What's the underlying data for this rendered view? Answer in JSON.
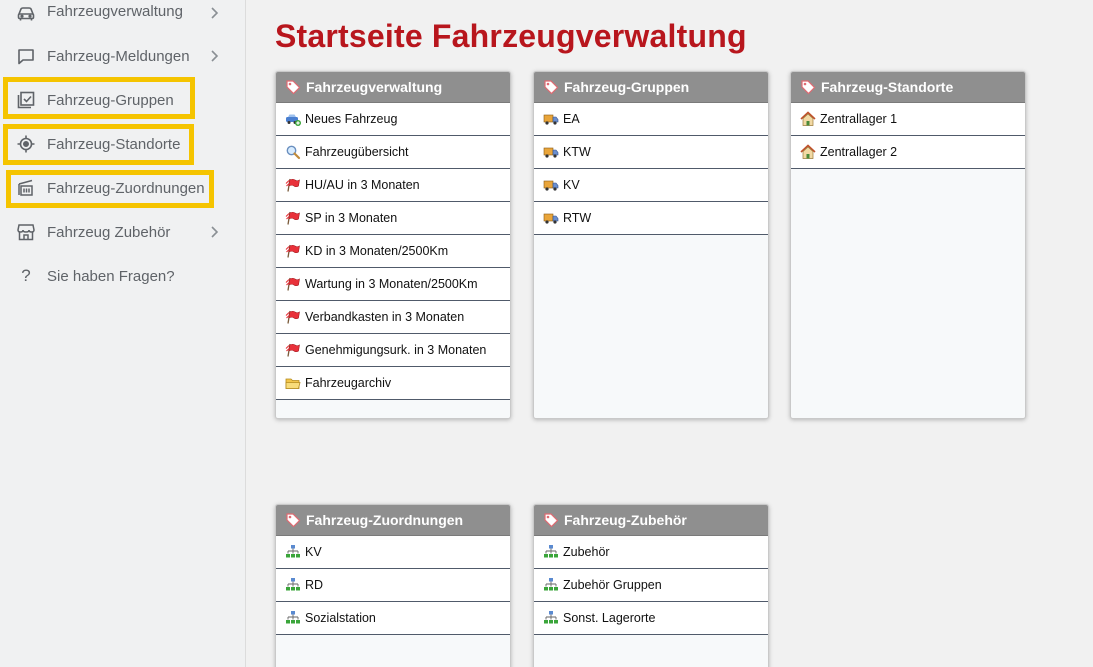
{
  "sidebar": {
    "items": [
      {
        "label": "Fahrzeugverwaltung",
        "icon": "car-icon",
        "has_chevron": true
      },
      {
        "label": "Fahrzeug-Meldungen",
        "icon": "message-icon",
        "has_chevron": true
      },
      {
        "label": "Fahrzeug-Gruppen",
        "icon": "checked-image-icon",
        "has_chevron": false
      },
      {
        "label": "Fahrzeug-Standorte",
        "icon": "target-location-icon",
        "has_chevron": false
      },
      {
        "label": "Fahrzeug-Zuordnungen",
        "icon": "assignment-icon",
        "has_chevron": false
      },
      {
        "label": "Fahrzeug Zubehör",
        "icon": "store-icon",
        "has_chevron": true
      },
      {
        "label": "Sie haben Fragen?",
        "icon": "question-icon",
        "has_chevron": false
      }
    ],
    "highlight_color": "#f5c400"
  },
  "main": {
    "title": "Startseite Fahrzeugverwaltung",
    "title_color": "#b8161d",
    "cards": [
      {
        "title": "Fahrzeugverwaltung",
        "rows": [
          {
            "label": "Neues Fahrzeug",
            "icon": "new-vehicle-icon"
          },
          {
            "label": "Fahrzeugübersicht",
            "icon": "magnifier-icon"
          },
          {
            "label": "HU/AU in 3 Monaten",
            "icon": "red-flag-icon"
          },
          {
            "label": "SP in 3 Monaten",
            "icon": "red-flag-icon"
          },
          {
            "label": "KD in 3 Monaten/2500Km",
            "icon": "red-flag-icon"
          },
          {
            "label": "Wartung in 3 Monaten/2500Km",
            "icon": "red-flag-icon"
          },
          {
            "label": "Verbandkasten in 3 Monaten",
            "icon": "red-flag-icon"
          },
          {
            "label": "Genehmigungsurk. in 3 Monaten",
            "icon": "red-flag-icon"
          },
          {
            "label": "Fahrzeugarchiv",
            "icon": "folder-icon"
          }
        ]
      },
      {
        "title": "Fahrzeug-Gruppen",
        "rows": [
          {
            "label": "EA",
            "icon": "truck-icon"
          },
          {
            "label": "KTW",
            "icon": "truck-icon"
          },
          {
            "label": "KV",
            "icon": "truck-icon"
          },
          {
            "label": "RTW",
            "icon": "truck-icon"
          }
        ]
      },
      {
        "title": "Fahrzeug-Standorte",
        "rows": [
          {
            "label": "Zentrallager 1",
            "icon": "house-icon"
          },
          {
            "label": "Zentrallager 2",
            "icon": "house-icon"
          }
        ]
      },
      {
        "title": "Fahrzeug-Zuordnungen",
        "rows": [
          {
            "label": "KV",
            "icon": "hierarchy-icon"
          },
          {
            "label": "RD",
            "icon": "hierarchy-icon"
          },
          {
            "label": "Sozialstation",
            "icon": "hierarchy-icon"
          }
        ]
      },
      {
        "title": "Fahrzeug-Zubehör",
        "rows": [
          {
            "label": "Zubehör",
            "icon": "hierarchy-icon"
          },
          {
            "label": "Zubehör Gruppen",
            "icon": "hierarchy-icon"
          },
          {
            "label": "Sonst. Lagerorte",
            "icon": "hierarchy-icon"
          }
        ]
      }
    ]
  }
}
